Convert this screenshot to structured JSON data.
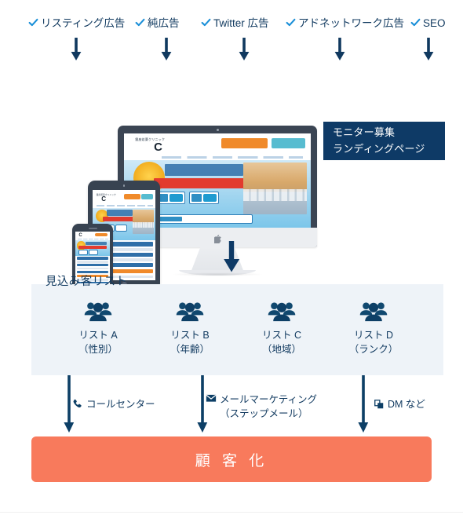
{
  "channels": {
    "items": [
      {
        "label": "リスティング広告",
        "icon": "check-icon"
      },
      {
        "label": "純広告",
        "icon": "check-icon"
      },
      {
        "label": "Twitter 広告",
        "icon": "check-icon"
      },
      {
        "label": "アドネットワーク広告",
        "icon": "check-icon"
      },
      {
        "label": "SEO",
        "icon": "check-icon"
      }
    ],
    "arrow_icon": "arrow-down-icon"
  },
  "hero": {
    "devices": [
      {
        "name": "desktop-monitor",
        "brand_icon": "apple-logo-icon"
      },
      {
        "name": "tablet-device"
      },
      {
        "name": "smartphone-device"
      }
    ],
    "callout": {
      "line1": "モニター募集",
      "line2": "ランディングページ",
      "bg_color": "#0e3a66",
      "text_color": "#ffffff"
    },
    "flow_arrow_icon": "arrow-down-icon"
  },
  "prospects": {
    "title": "見込み客リスト",
    "panel_bg": "#eef3f8",
    "items": [
      {
        "icon": "users-group-icon",
        "name": "リスト A",
        "attribute": "（性別）"
      },
      {
        "icon": "users-group-icon",
        "name": "リスト B",
        "attribute": "（年齢）"
      },
      {
        "icon": "users-group-icon",
        "name": "リスト C",
        "attribute": "（地域）"
      },
      {
        "icon": "users-group-icon",
        "name": "リスト D",
        "attribute": "（ランク）"
      }
    ]
  },
  "outreach": {
    "items": [
      {
        "icon": "phone-icon",
        "line1": "コールセンター",
        "line2": ""
      },
      {
        "icon": "mail-icon",
        "line1": "メールマーケティング",
        "line2": "（ステップメール）"
      },
      {
        "icon": "documents-icon",
        "line1": "DM など",
        "line2": ""
      }
    ],
    "arrow_icon": "arrow-down-icon"
  },
  "cta": {
    "label": "顧 客 化",
    "bg_color": "#f87a5c",
    "text_color": "#ffffff"
  },
  "colors": {
    "navy": "#10395f",
    "deep_navy": "#0e3a66",
    "accent_blue": "#1a8fd8",
    "panel": "#eef3f8",
    "coral": "#f87a5c"
  }
}
